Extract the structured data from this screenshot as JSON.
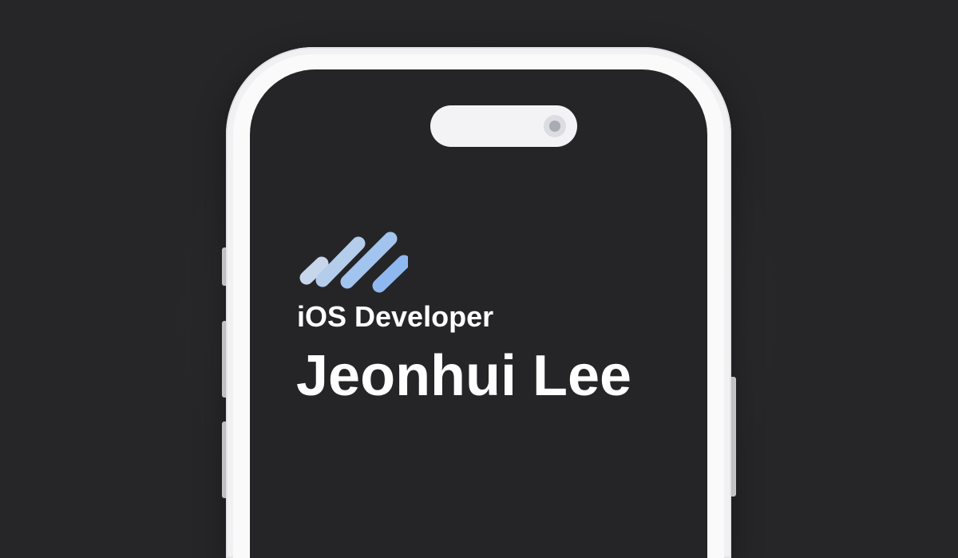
{
  "profile": {
    "role": "iOS Developer",
    "name": "Jeonhui Lee"
  },
  "logo": {
    "icon": "diagonal-bars-logo",
    "colors": [
      "#c7d6ea",
      "#b3cdeb",
      "#a3c4ef",
      "#8fb8f0"
    ]
  },
  "device": {
    "frame_color": "#f1f1f3",
    "screen_color": "#252527",
    "background_color": "#262628"
  }
}
